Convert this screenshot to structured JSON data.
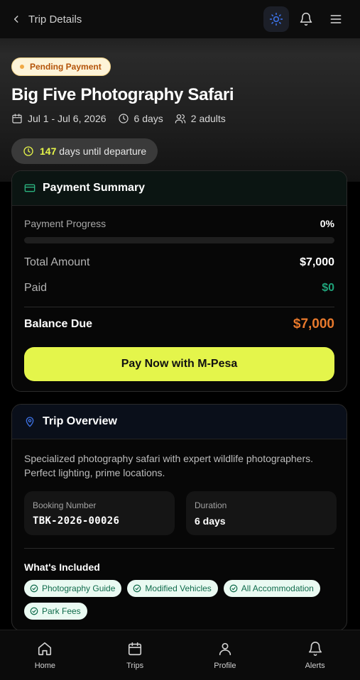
{
  "header": {
    "back_label": "Trip Details"
  },
  "status_badge": "Pending Payment",
  "trip": {
    "title": "Big Five Photography Safari",
    "dates": "Jul 1 - Jul 6, 2026",
    "duration": "6 days",
    "travelers": "2 adults",
    "countdown_number": "147",
    "countdown_suffix": "days until departure"
  },
  "payment": {
    "heading": "Payment Summary",
    "progress_label": "Payment Progress",
    "progress_text": "0%",
    "progress_fraction": 0,
    "total_label": "Total Amount",
    "total_value": "$7,000",
    "paid_label": "Paid",
    "paid_value": "$0",
    "balance_label": "Balance Due",
    "balance_value": "$7,000",
    "pay_button": "Pay Now with M-Pesa"
  },
  "overview": {
    "heading": "Trip Overview",
    "description": "Specialized photography safari with expert wildlife photographers. Perfect lighting, prime locations.",
    "booking_label": "Booking Number",
    "booking_value": "TBK-2026-00026",
    "duration_label": "Duration",
    "duration_value": "6 days",
    "included_title": "What's Included",
    "included": [
      "Photography Guide",
      "Modified Vehicles",
      "All Accommodation",
      "Park Fees"
    ]
  },
  "nav": [
    {
      "label": "Home",
      "icon": "home-icon"
    },
    {
      "label": "Trips",
      "icon": "calendar-icon"
    },
    {
      "label": "Profile",
      "icon": "user-icon"
    },
    {
      "label": "Alerts",
      "icon": "bell-icon"
    }
  ],
  "colors": {
    "accent": "#e4f54b",
    "balance": "#e8792c",
    "paid": "#1fa37a",
    "pending_bg": "#fdf3d8",
    "pending_text": "#b45309"
  }
}
